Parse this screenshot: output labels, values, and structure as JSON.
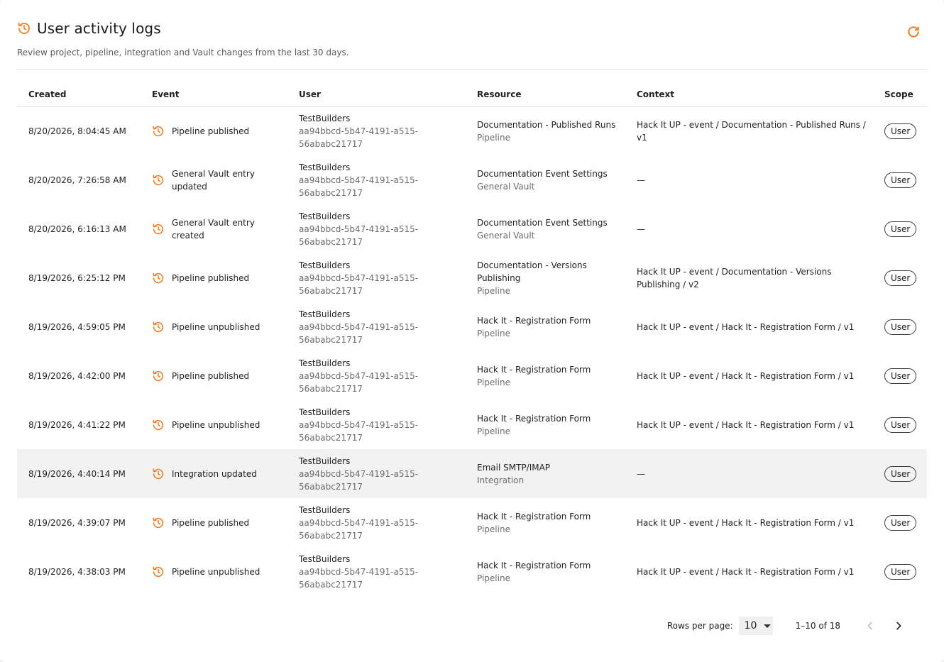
{
  "header": {
    "title": "User activity logs",
    "subtitle": "Review project, pipeline, integration and Vault changes from the last 30 days."
  },
  "colors": {
    "accent": "#f07a20"
  },
  "table": {
    "columns": [
      "Created",
      "Event",
      "User",
      "Resource",
      "Context",
      "Scope"
    ],
    "rows": [
      {
        "created": "8/20/2026, 8:04:45 AM",
        "event": "Pipeline published",
        "user_name": "TestBuilders",
        "user_id": "aa94bbcd-5b47-4191-a515-56ababc21717",
        "resource_name": "Documentation - Published Runs",
        "resource_type": "Pipeline",
        "context": "Hack It UP - event / Documentation - Published Runs / v1",
        "scope": "User"
      },
      {
        "created": "8/20/2026, 7:26:58 AM",
        "event": "General Vault entry updated",
        "user_name": "TestBuilders",
        "user_id": "aa94bbcd-5b47-4191-a515-56ababc21717",
        "resource_name": "Documentation Event Settings",
        "resource_type": "General Vault",
        "context": "—",
        "scope": "User"
      },
      {
        "created": "8/20/2026, 6:16:13 AM",
        "event": "General Vault entry created",
        "user_name": "TestBuilders",
        "user_id": "aa94bbcd-5b47-4191-a515-56ababc21717",
        "resource_name": "Documentation Event Settings",
        "resource_type": "General Vault",
        "context": "—",
        "scope": "User"
      },
      {
        "created": "8/19/2026, 6:25:12 PM",
        "event": "Pipeline published",
        "user_name": "TestBuilders",
        "user_id": "aa94bbcd-5b47-4191-a515-56ababc21717",
        "resource_name": "Documentation - Versions Publishing",
        "resource_type": "Pipeline",
        "context": "Hack It UP - event / Documentation - Versions Publishing / v2",
        "scope": "User"
      },
      {
        "created": "8/19/2026, 4:59:05 PM",
        "event": "Pipeline unpublished",
        "user_name": "TestBuilders",
        "user_id": "aa94bbcd-5b47-4191-a515-56ababc21717",
        "resource_name": "Hack It - Registration Form",
        "resource_type": "Pipeline",
        "context": "Hack It UP - event / Hack It - Registration Form / v1",
        "scope": "User"
      },
      {
        "created": "8/19/2026, 4:42:00 PM",
        "event": "Pipeline published",
        "user_name": "TestBuilders",
        "user_id": "aa94bbcd-5b47-4191-a515-56ababc21717",
        "resource_name": "Hack It - Registration Form",
        "resource_type": "Pipeline",
        "context": "Hack It UP - event / Hack It - Registration Form / v1",
        "scope": "User"
      },
      {
        "created": "8/19/2026, 4:41:22 PM",
        "event": "Pipeline unpublished",
        "user_name": "TestBuilders",
        "user_id": "aa94bbcd-5b47-4191-a515-56ababc21717",
        "resource_name": "Hack It - Registration Form",
        "resource_type": "Pipeline",
        "context": "Hack It UP - event / Hack It - Registration Form / v1",
        "scope": "User"
      },
      {
        "created": "8/19/2026, 4:40:14 PM",
        "event": "Integration updated",
        "user_name": "TestBuilders",
        "user_id": "aa94bbcd-5b47-4191-a515-56ababc21717",
        "resource_name": "Email SMTP/IMAP",
        "resource_type": "Integration",
        "context": "—",
        "scope": "User",
        "highlighted": true
      },
      {
        "created": "8/19/2026, 4:39:07 PM",
        "event": "Pipeline published",
        "user_name": "TestBuilders",
        "user_id": "aa94bbcd-5b47-4191-a515-56ababc21717",
        "resource_name": "Hack It - Registration Form",
        "resource_type": "Pipeline",
        "context": "Hack It UP - event / Hack It - Registration Form / v1",
        "scope": "User"
      },
      {
        "created": "8/19/2026, 4:38:03 PM",
        "event": "Pipeline unpublished",
        "user_name": "TestBuilders",
        "user_id": "aa94bbcd-5b47-4191-a515-56ababc21717",
        "resource_name": "Hack It - Registration Form",
        "resource_type": "Pipeline",
        "context": "Hack It UP - event / Hack It - Registration Form / v1",
        "scope": "User"
      }
    ]
  },
  "pagination": {
    "rows_per_page_label": "Rows per page:",
    "rows_per_page_value": "10",
    "range": "1–10 of 18"
  }
}
